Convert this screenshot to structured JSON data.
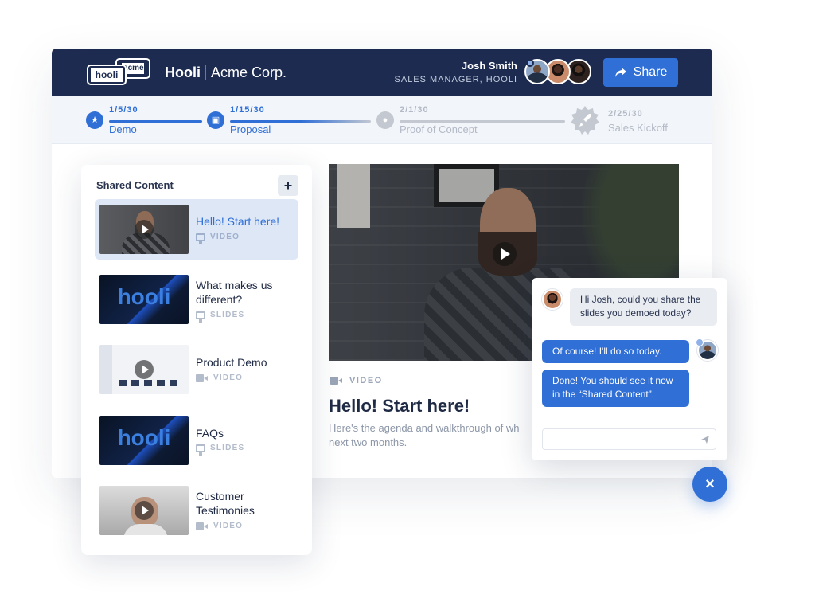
{
  "header": {
    "logo_back": "Acme",
    "logo_front": "hooli",
    "brand_primary": "Hooli",
    "brand_secondary": "Acme Corp.",
    "user_name": "Josh Smith",
    "user_role": "SALES MANAGER, HOOLI",
    "share_label": "Share",
    "share_icon": "share-arrow-icon"
  },
  "colors": {
    "header_bg": "#1c2b4f",
    "accent": "#2f6fd6",
    "step_done": "#2f6fd6",
    "step_pending": "#c3c8d1"
  },
  "milestones": [
    {
      "date": "1/5/30",
      "name": "Demo",
      "icon": "star-icon",
      "status": "done",
      "progress": 1.0
    },
    {
      "date": "1/15/30",
      "name": "Proposal",
      "icon": "document-icon",
      "status": "done",
      "progress": 0.6
    },
    {
      "date": "2/1/30",
      "name": "Proof of Concept",
      "icon": "person-icon",
      "status": "pending",
      "progress": 0.0
    },
    {
      "date": "2/25/30",
      "name": "Sales Kickoff",
      "icon": "rocket-icon",
      "status": "pending"
    }
  ],
  "shared_content": {
    "title": "Shared Content",
    "add_label": "+",
    "items": [
      {
        "title": "Hello! Start here!",
        "type": "VIDEO",
        "icon": "video-icon",
        "thumb": "person",
        "active": true
      },
      {
        "title": "What makes us different?",
        "type": "SLIDES",
        "icon": "slides-icon",
        "thumb_text": "hooli",
        "active": false
      },
      {
        "title": "Product Demo",
        "type": "VIDEO",
        "icon": "video-icon",
        "thumb": "demo",
        "active": false
      },
      {
        "title": "FAQs",
        "type": "SLIDES",
        "icon": "slides-icon",
        "thumb_text": "hooli",
        "active": false
      },
      {
        "title": "Customer Testimonies",
        "type": "VIDEO",
        "icon": "video-icon",
        "thumb": "person",
        "active": false
      }
    ]
  },
  "main": {
    "video_type": "VIDEO",
    "video_title": "Hello! Start here!",
    "description_line1": "Here's the agenda and walkthrough of wh",
    "description_line2": "next two months."
  },
  "chat": {
    "messages": [
      {
        "from": "customer",
        "text": "Hi Josh, could you share the slides you demoed today?"
      },
      {
        "from": "me",
        "text": "Of course! I'll do so today."
      },
      {
        "from": "me",
        "text": "Done! You should see it now in the “Shared Content”."
      }
    ],
    "input_value": "",
    "send_icon": "send-icon",
    "close_label": "×"
  }
}
